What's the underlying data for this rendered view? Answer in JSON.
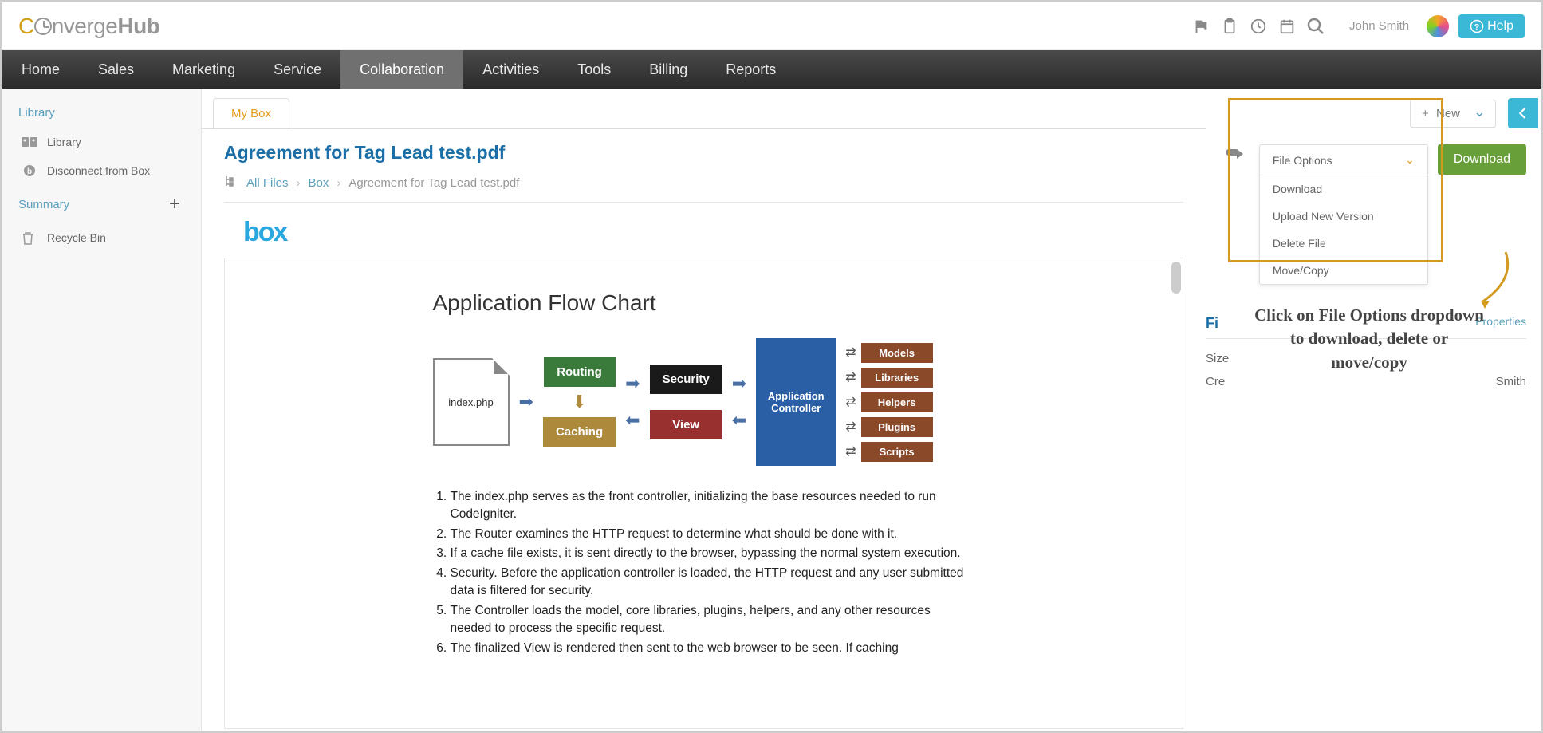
{
  "header": {
    "username": "John Smith",
    "help_label": "Help"
  },
  "nav": {
    "items": [
      "Home",
      "Sales",
      "Marketing",
      "Service",
      "Collaboration",
      "Activities",
      "Tools",
      "Billing",
      "Reports"
    ],
    "active_index": 4
  },
  "sidebar": {
    "library_label": "Library",
    "items": [
      {
        "label": "Library"
      },
      {
        "label": "Disconnect from Box"
      }
    ],
    "summary_label": "Summary",
    "recycle_label": "Recycle Bin"
  },
  "tabs": {
    "active": "My Box"
  },
  "file": {
    "title": "Agreement for Tag Lead test.pdf"
  },
  "breadcrumb": {
    "items": [
      "All Files",
      "Box",
      "Agreement for Tag Lead test.pdf"
    ]
  },
  "box_logo": "box",
  "document": {
    "title": "Application Flow Chart",
    "file_name": "index.php",
    "nodes": {
      "routing": "Routing",
      "caching": "Caching",
      "security": "Security",
      "view": "View",
      "app_controller": "Application Controller",
      "models": "Models",
      "libraries": "Libraries",
      "helpers": "Helpers",
      "plugins": "Plugins",
      "scripts": "Scripts"
    },
    "list": [
      "The index.php serves as the front controller, initializing the base resources needed to run CodeIgniter.",
      "The Router examines the HTTP request to determine what should be done with it.",
      "If a cache file exists, it is sent directly to the browser, bypassing the normal system execution.",
      "Security. Before the application controller is loaded, the HTTP request and any user submitted data is filtered for security.",
      "The Controller loads the model, core libraries, plugins, helpers, and any other resources needed to process the specific request.",
      "The finalized View is rendered then sent to the web browser to be seen. If caching"
    ]
  },
  "actions": {
    "new_label": "New",
    "download_label": "Download",
    "file_options_label": "File Options",
    "file_options_items": [
      "Download",
      "Upload New Version",
      "Delete File",
      "Move/Copy"
    ]
  },
  "info": {
    "title_prefix": "Fi",
    "size_label": "Size",
    "created_prefix": "Cre",
    "created_suffix": "Smith",
    "properties_label": "Properties"
  },
  "annotation": {
    "line1": "Click on File Options dropdown",
    "line2": "to download, delete or",
    "line3": "move/copy"
  }
}
